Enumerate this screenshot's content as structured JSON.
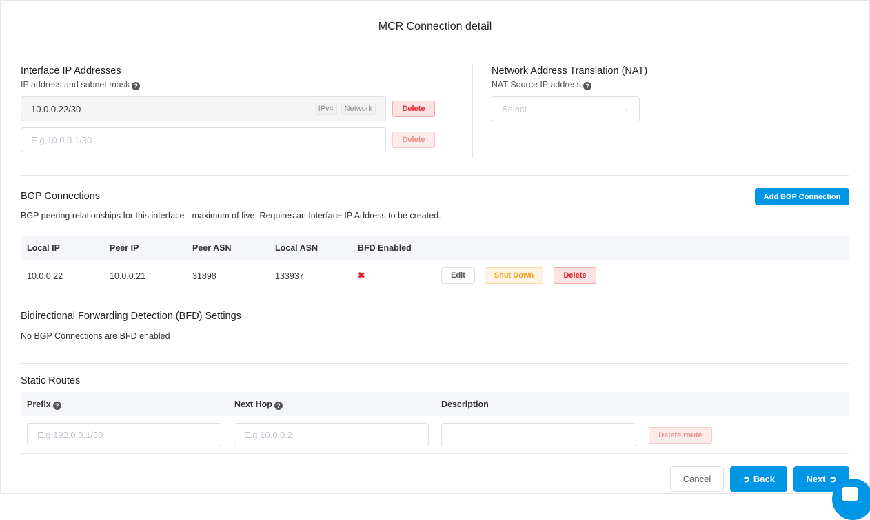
{
  "title": "MCR Connection detail",
  "interface": {
    "heading": "Interface IP Addresses",
    "sub": "IP address and subnet mask",
    "value": "10.0.0.22/30",
    "tags": [
      "IPv4",
      "Network"
    ],
    "placeholder": "E.g.10.0.0.1/30",
    "delete": "Delete"
  },
  "nat": {
    "heading": "Network Address Translation (NAT)",
    "sub": "NAT Source IP address",
    "placeholder": "Select"
  },
  "bgp": {
    "heading": "BGP Connections",
    "desc": "BGP peering relationships for this interface - maximum of five. Requires an Interface IP Address to be created.",
    "add": "Add BGP Connection",
    "columns": [
      "Local IP",
      "Peer IP",
      "Peer ASN",
      "Local ASN",
      "BFD Enabled"
    ],
    "rows": [
      {
        "local_ip": "10.0.0.22",
        "peer_ip": "10.0.0.21",
        "peer_asn": "31898",
        "local_asn": "133937",
        "bfd": "✖"
      }
    ],
    "edit": "Edit",
    "shutdown": "Shut Down",
    "delete": "Delete"
  },
  "bfd": {
    "heading": "Bidirectional Forwarding Detection (BFD) Settings",
    "text": "No BGP Connections are BFD enabled"
  },
  "static": {
    "heading": "Static Routes",
    "columns": [
      "Prefix",
      "Next Hop",
      "Description"
    ],
    "prefix_ph": "E.g.192.0.0.1/30",
    "hop_ph": "E.g.10.0.0.2",
    "delete": "Delete route"
  },
  "footer": {
    "cancel": "Cancel",
    "back": "Back",
    "next": "Next"
  }
}
